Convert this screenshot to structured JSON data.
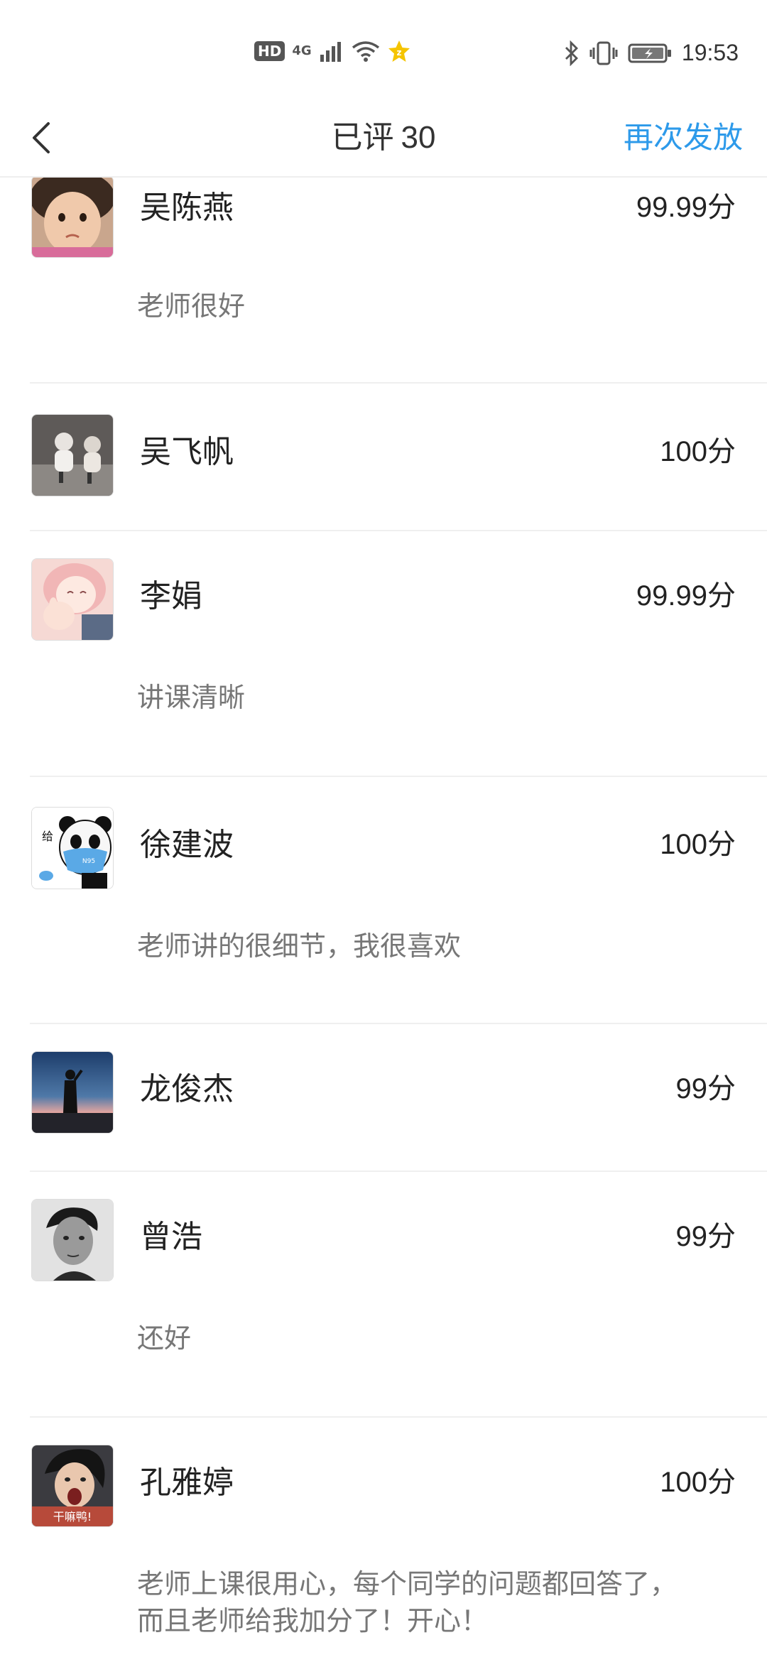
{
  "status_bar": {
    "network_badge": "HD",
    "network_type": "4G",
    "time": "19:53"
  },
  "header": {
    "title": "已评",
    "count": "30",
    "action_label": "再次发放"
  },
  "items": [
    {
      "name": "吴陈燕",
      "score": "99.99分",
      "comment": "老师很好",
      "avatar": "child-photo-avatar"
    },
    {
      "name": "吴飞帆",
      "score": "100分",
      "comment": "",
      "avatar": "kids-photo-avatar"
    },
    {
      "name": "李娟",
      "score": "99.99分",
      "comment": "讲课清晰",
      "avatar": "anime-girl-avatar"
    },
    {
      "name": "徐建波",
      "score": "100分",
      "comment": "老师讲的很细节，我很喜欢",
      "avatar": "panda-meme-avatar",
      "avatar_text": "给"
    },
    {
      "name": "龙俊杰",
      "score": "99分",
      "comment": "",
      "avatar": "sunset-silhouette-avatar"
    },
    {
      "name": "曾浩",
      "score": "99分",
      "comment": "还好",
      "avatar": "bw-portrait-avatar"
    },
    {
      "name": "孔雅婷",
      "score": "100分",
      "comment": "老师上课很用心，每个同学的问题都回答了，而且老师给我加分了！开心！",
      "avatar": "meme-shout-avatar",
      "avatar_text": "干嘛鸭!"
    }
  ],
  "colors": {
    "accent": "#2d9aea",
    "divider": "#efefef",
    "comment_text": "#777777"
  }
}
